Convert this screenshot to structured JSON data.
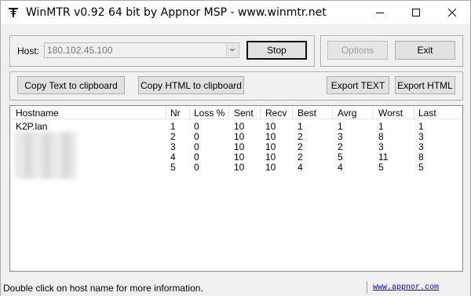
{
  "window": {
    "title": "WinMTR v0.92 64 bit by Appnor MSP - www.winmtr.net",
    "icon": "winmtr-app-icon"
  },
  "host": {
    "label": "Host:",
    "value": "180.102.45.100",
    "dropdown_icon": "chevron-down-icon"
  },
  "buttons": {
    "stop": "Stop",
    "options": "Options",
    "exit": "Exit",
    "copy_text": "Copy Text to clipboard",
    "copy_html": "Copy HTML to clipboard",
    "export_text": "Export TEXT",
    "export_html": "Export HTML"
  },
  "table": {
    "columns": [
      "Hostname",
      "Nr",
      "Loss %",
      "Sent",
      "Recv",
      "Best",
      "Avrg",
      "Worst",
      "Last"
    ],
    "rows": [
      [
        "K2P.lan",
        "1",
        "0",
        "10",
        "10",
        "1",
        "1",
        "1",
        "1"
      ],
      [
        "",
        "2",
        "0",
        "10",
        "10",
        "2",
        "3",
        "8",
        "3"
      ],
      [
        "",
        "3",
        "0",
        "10",
        "10",
        "2",
        "2",
        "3",
        "3"
      ],
      [
        "",
        "4",
        "0",
        "10",
        "10",
        "2",
        "5",
        "11",
        "8"
      ],
      [
        "",
        "5",
        "0",
        "10",
        "10",
        "4",
        "4",
        "5",
        "5"
      ]
    ]
  },
  "status": {
    "message": "Double click on host name for more information.",
    "link": "www.appnor.com"
  },
  "colors": {
    "link": "#0000ff",
    "disabled_text": "#a0a0a0",
    "window_bg": "#f0f0f0"
  }
}
